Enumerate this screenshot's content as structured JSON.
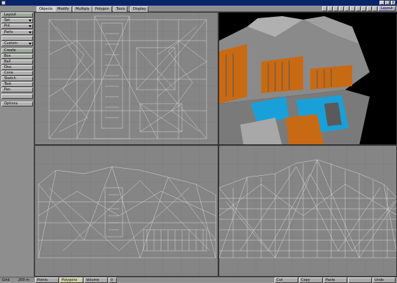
{
  "window": {
    "close": "X",
    "maximize": "□",
    "minimize": "_"
  },
  "tabs": [
    "Objects",
    "Modify",
    "Multiply",
    "Polygon",
    "Tools",
    "Display"
  ],
  "toolbar_right": {
    "layout_label": "Layout"
  },
  "sidebar": {
    "top": [
      {
        "label": "Layout",
        "kind": "header"
      },
      {
        "label": "Set",
        "kind": "dropdown"
      },
      {
        "label": "Pnt",
        "kind": "dropdown"
      },
      {
        "label": "Parts",
        "kind": "dropdown"
      },
      {
        "label": "Custom",
        "kind": "dropdown"
      }
    ],
    "create_header": "Create",
    "create_items": [
      "Box",
      "Ball",
      "Disc",
      "Cone",
      "Sketch",
      "Text",
      "Pen"
    ],
    "options_label": "Options"
  },
  "viewports": {
    "top_right_label": "Perspective"
  },
  "status": {
    "grid_label": "Grid",
    "grid_value": "200 m",
    "modes": [
      "Points",
      "Polygons",
      "Volume"
    ],
    "mode_count": "0",
    "edit_buttons": [
      "Cut",
      "Copy",
      "Paste",
      "",
      "Undo"
    ]
  },
  "colors": {
    "accent_title": "#0a246a",
    "water": "#1aa0d8",
    "orange": "#c86a14",
    "stone": "#a8a8a8"
  }
}
